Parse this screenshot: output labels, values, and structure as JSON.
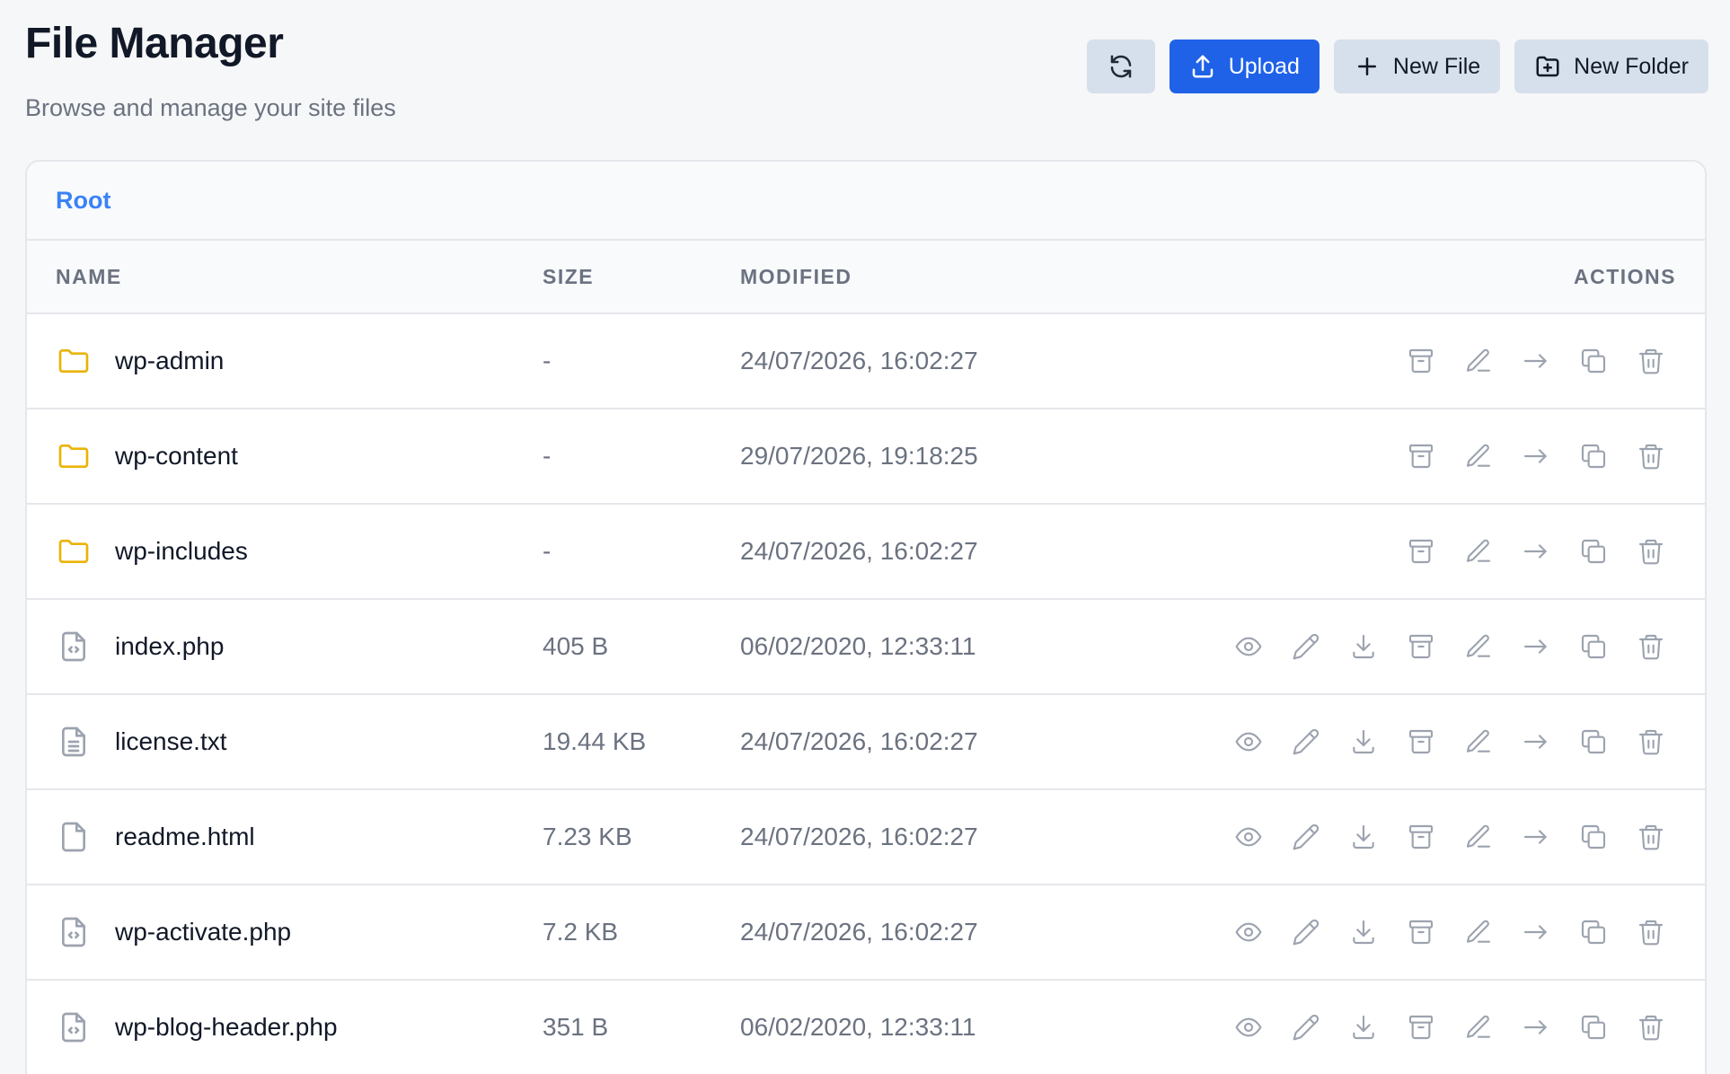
{
  "header": {
    "title": "File Manager",
    "subtitle": "Browse and manage your site files"
  },
  "toolbar": {
    "refresh_icon": "refresh-icon",
    "upload_label": "Upload",
    "new_file_label": "New File",
    "new_folder_label": "New Folder"
  },
  "breadcrumb": {
    "root_label": "Root"
  },
  "table": {
    "columns": {
      "name": "NAME",
      "size": "SIZE",
      "modified": "MODIFIED",
      "actions": "ACTIONS"
    },
    "rows": [
      {
        "name": "wp-admin",
        "size": "-",
        "modified": "24/07/2026, 16:02:27",
        "type": "folder"
      },
      {
        "name": "wp-content",
        "size": "-",
        "modified": "29/07/2026, 19:18:25",
        "type": "folder"
      },
      {
        "name": "wp-includes",
        "size": "-",
        "modified": "24/07/2026, 16:02:27",
        "type": "folder"
      },
      {
        "name": "index.php",
        "size": "405 B",
        "modified": "06/02/2020, 12:33:11",
        "type": "code"
      },
      {
        "name": "license.txt",
        "size": "19.44 KB",
        "modified": "24/07/2026, 16:02:27",
        "type": "text"
      },
      {
        "name": "readme.html",
        "size": "7.23 KB",
        "modified": "24/07/2026, 16:02:27",
        "type": "file"
      },
      {
        "name": "wp-activate.php",
        "size": "7.2 KB",
        "modified": "24/07/2026, 16:02:27",
        "type": "code"
      },
      {
        "name": "wp-blog-header.php",
        "size": "351 B",
        "modified": "06/02/2020, 12:33:11",
        "type": "code"
      }
    ]
  },
  "colors": {
    "primary": "#1f62e8",
    "folder": "#eab308",
    "icon_gray": "#9ca3af",
    "link": "#3b82f6"
  }
}
